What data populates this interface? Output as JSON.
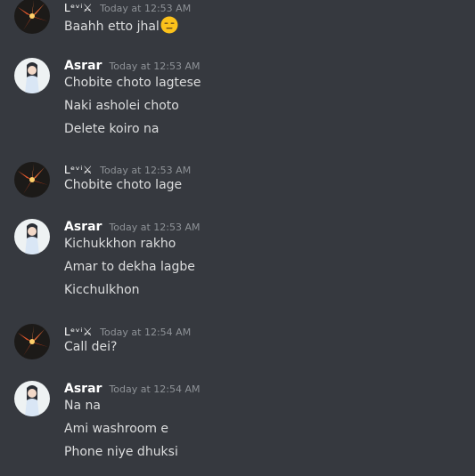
{
  "messages": [
    {
      "author": "Levi",
      "author_display": "Lᵉᵛⁱ⚔",
      "avatar": "orange-flower-avatar",
      "timestamp": "Today at 12:53 AM",
      "lines": [
        "Baahh etto jhal"
      ],
      "emoji": "expressionless-face-emoji"
    },
    {
      "author": "Asrar",
      "author_display": "Asrar",
      "avatar": "anime-girl-avatar",
      "timestamp": "Today at 12:53 AM",
      "lines": [
        "Chobite choto lagtese",
        "Naki asholei choto",
        "Delete koiro na"
      ]
    },
    {
      "author": "Levi",
      "author_display": "Lᵉᵛⁱ⚔",
      "avatar": "orange-flower-avatar",
      "timestamp": "Today at 12:53 AM",
      "lines": [
        "Chobite choto lage"
      ]
    },
    {
      "author": "Asrar",
      "author_display": "Asrar",
      "avatar": "anime-girl-avatar",
      "timestamp": "Today at 12:53 AM",
      "lines": [
        "Kichukkhon rakho",
        "Amar to dekha lagbe",
        "Kicchulkhon"
      ]
    },
    {
      "author": "Levi",
      "author_display": "Lᵉᵛⁱ⚔",
      "avatar": "orange-flower-avatar",
      "timestamp": "Today at 12:54 AM",
      "lines": [
        "Call dei?"
      ]
    },
    {
      "author": "Asrar",
      "author_display": "Asrar",
      "avatar": "anime-girl-avatar",
      "timestamp": "Today at 12:54 AM",
      "lines": [
        "Na na",
        "Ami washroom e",
        "Phone niye dhuksi"
      ]
    }
  ]
}
